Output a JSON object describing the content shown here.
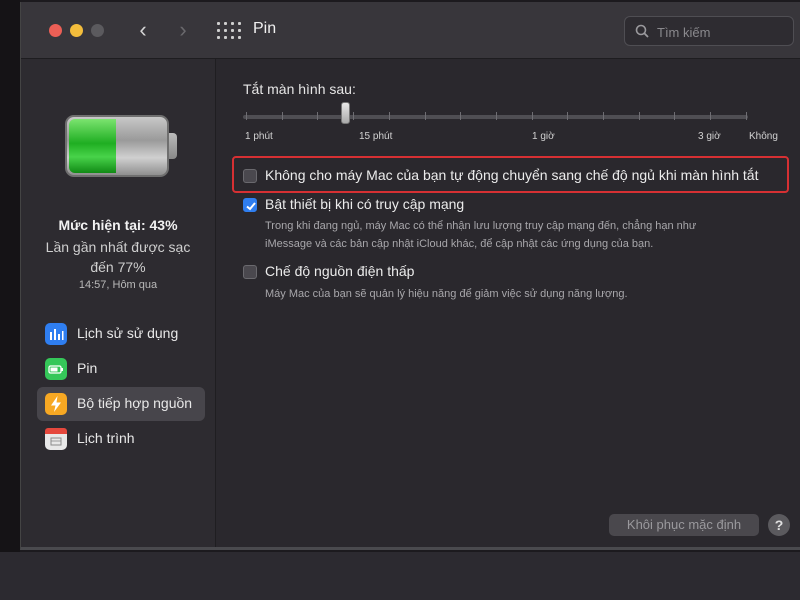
{
  "window": {
    "title": "Pin",
    "search_placeholder": "Tìm kiếm"
  },
  "battery_status": {
    "level_text": "Mức hiện tại: 43%",
    "level_percent": 43,
    "last_charged_line1": "Lần gần nhất được sạc",
    "last_charged_line2": "đến 77%",
    "time": "14:57, Hôm qua"
  },
  "sidebar": {
    "items": [
      {
        "label": "Lịch sử sử dụng",
        "icon": "bar-chart-icon",
        "color": "#2f7ef0"
      },
      {
        "label": "Pin",
        "icon": "battery-icon",
        "color": "#35c759"
      },
      {
        "label": "Bộ tiếp hợp nguồn",
        "icon": "lightning-icon",
        "color": "#f7a823",
        "selected": true
      },
      {
        "label": "Lịch trình",
        "icon": "calendar-icon",
        "color": "#e8e8e8"
      }
    ]
  },
  "display_sleep": {
    "title": "Tắt màn hình sau:",
    "ticks": [
      "1 phút",
      "15 phút",
      "1 giờ",
      "3 giờ",
      "Không"
    ]
  },
  "options": {
    "prevent_sleep": {
      "label": "Không cho máy Mac của bạn tự động chuyển sang chế độ ngủ khi màn hình tắt",
      "checked": false
    },
    "wake_network": {
      "label": "Bật thiết bị khi có truy cập mạng",
      "checked": true,
      "desc_line1": "Trong khi đang ngủ, máy Mac có thể nhận lưu lượng truy cập mạng đến, chẳng hạn như",
      "desc_line2": "iMessage và các bản cập nhật iCloud khác, để cập nhật các ứng dụng của bạn."
    },
    "low_power": {
      "label": "Chế độ nguồn điện thấp",
      "checked": false,
      "desc": "Máy Mac của bạn sẽ quản lý hiệu năng để giảm việc sử dụng năng lượng."
    }
  },
  "footer": {
    "restore_label": "Khôi phục mặc định",
    "help_label": "?"
  },
  "colors": {
    "highlight": "#d63033",
    "accent": "#2f7ef0"
  }
}
